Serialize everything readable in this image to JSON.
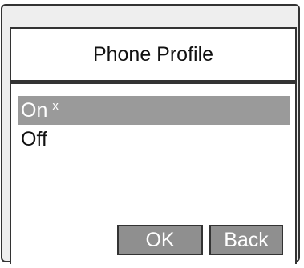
{
  "screen": {
    "title": "Phone Profile"
  },
  "options": [
    {
      "label": "On",
      "selected": true,
      "mark": "x"
    },
    {
      "label": "Off",
      "selected": false,
      "mark": ""
    }
  ],
  "softkeys": {
    "ok_label": "OK",
    "back_label": "Back"
  },
  "colors": {
    "highlight": "#9a9a9a",
    "button": "#8f8f8f",
    "frame": "#eeeeee"
  }
}
